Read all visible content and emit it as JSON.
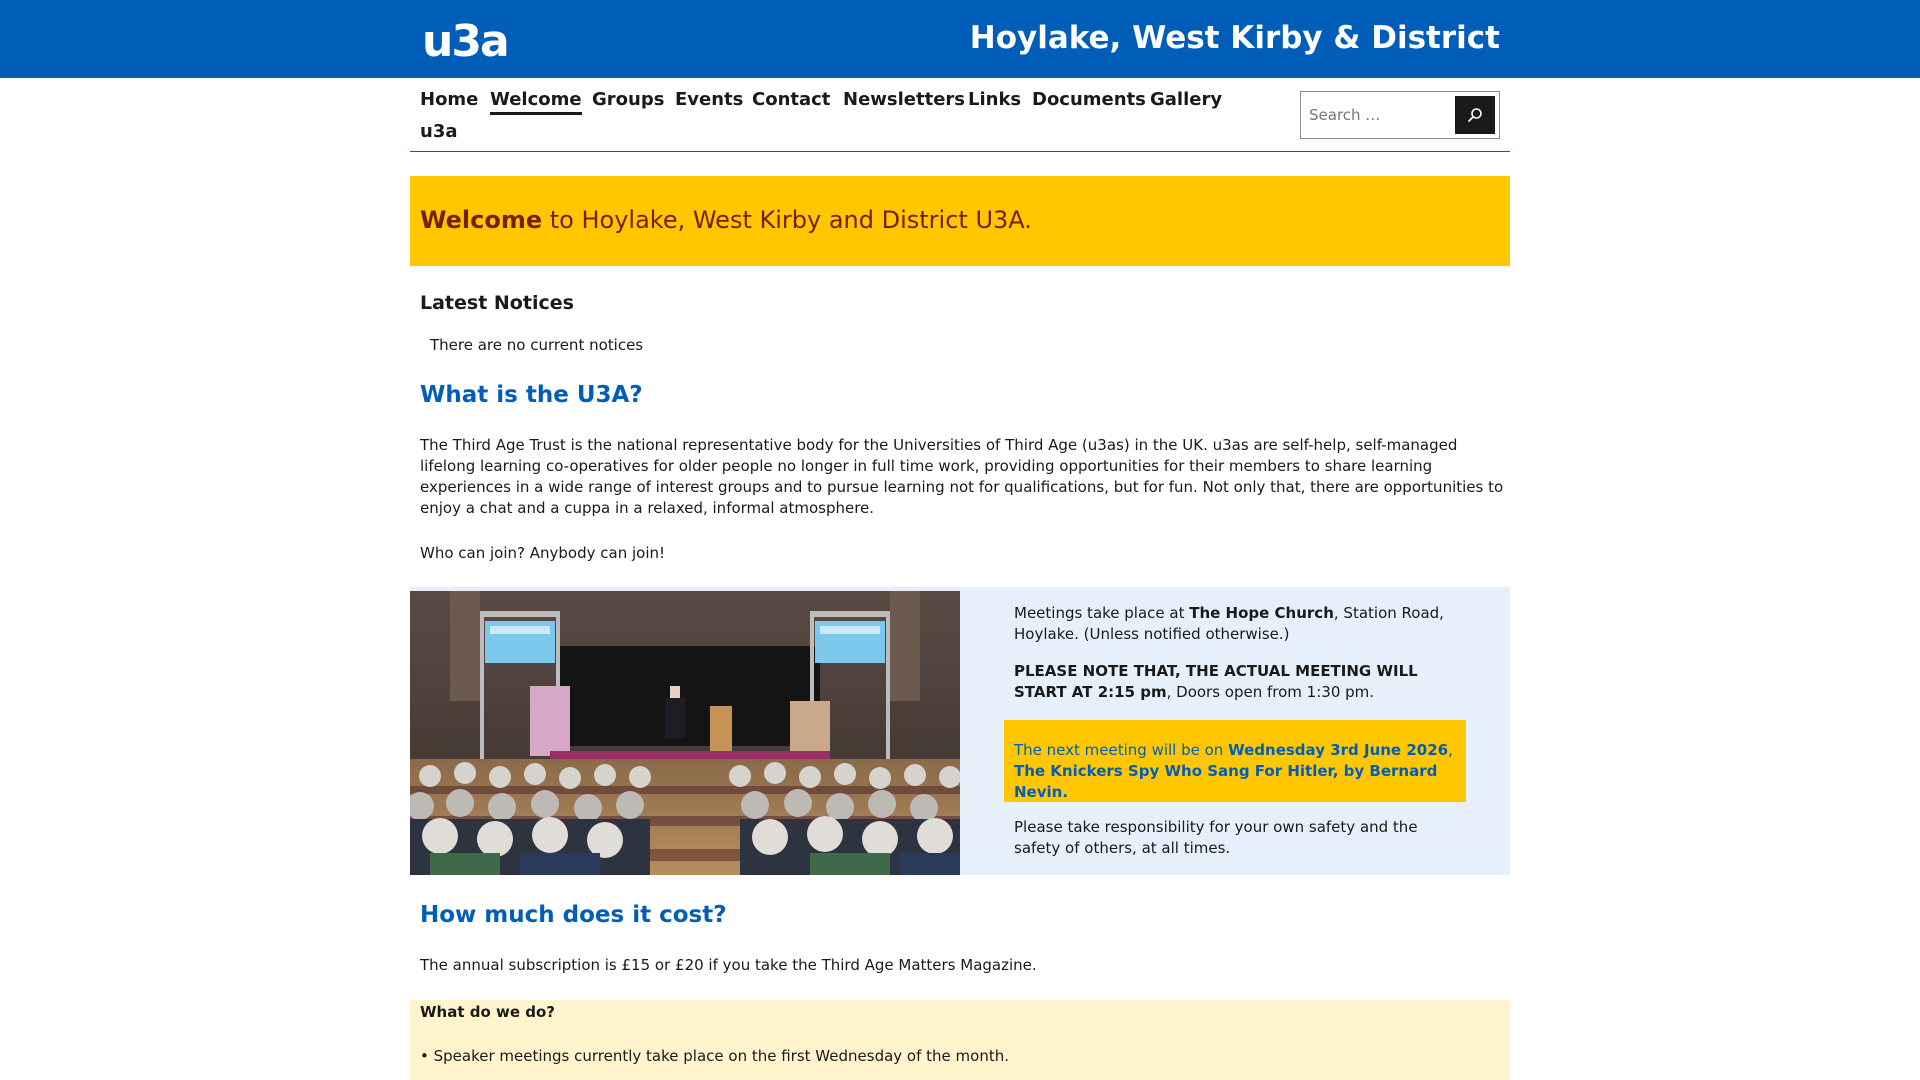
{
  "header": {
    "logo": "u3a",
    "site_title": "Hoylake, West Kirby & District"
  },
  "nav": {
    "items": [
      {
        "label": "Home",
        "active": false
      },
      {
        "label": "Welcome",
        "active": true
      },
      {
        "label": "Groups",
        "active": false
      },
      {
        "label": "Events",
        "active": false
      },
      {
        "label": "Contact",
        "active": false
      },
      {
        "label": "Newsletters",
        "active": false
      },
      {
        "label": "Links",
        "active": false
      },
      {
        "label": "Documents",
        "active": false
      },
      {
        "label": "Gallery",
        "active": false
      },
      {
        "label": "u3a",
        "active": false
      }
    ]
  },
  "search": {
    "placeholder": "Search …",
    "icon": "search-icon"
  },
  "welcome": {
    "bold": "Welcome",
    "rest": " to Hoylake, West Kirby and District U3A."
  },
  "notices": {
    "heading": "Latest Notices",
    "empty_text": "There are no current notices"
  },
  "about": {
    "heading": "What is the U3A?",
    "body": "The Third Age Trust is the national representative body for the Universities of Third Age (u3as) in the UK. u3as are self-help, self-managed lifelong learning co-operatives for older people no longer in full time work, providing opportunities for their members to share learning experiences in a wide range of interest groups and to pursue learning not for qualifications, but for fun. Not only that, there are opportunities to enjoy a chat and a cuppa in a relaxed, informal atmosphere.",
    "join": "Who can join? Anybody can join!"
  },
  "meetings": {
    "location_prefix": "Meetings take place at ",
    "location_bold": "The Hope Church",
    "location_suffix": ", Station Road, Hoylake. (Unless notified otherwise.)",
    "note_bold": "PLEASE NOTE THAT, THE ACTUAL MEETING WILL START AT 2:15 pm",
    "note_suffix": ", Doors open from 1:30 pm.",
    "next_prefix": "The next meeting will be on ",
    "next_date": "Wednesday 3rd June 2026",
    "next_sep": ", ",
    "next_title": "The Knickers Spy Who Sang For Hitler, by Bernard Nevin.",
    "safety": "Please take responsibility for your own safety and the safety of others, at all times."
  },
  "cost": {
    "heading": "How much does it cost?",
    "body": "The annual subscription is £15 or £20 if you take the Third Age Matters Magazine."
  },
  "activities": {
    "heading": "What do we do?",
    "bullet": "• Speaker meetings currently take place on the first Wednesday of the month."
  },
  "colors": {
    "brand_blue": "#005EB8",
    "brand_yellow": "#FFC700",
    "welcome_text": "#7A1E00",
    "panel_blue": "#E6F0FA",
    "panel_cream": "#FFF4CC"
  }
}
